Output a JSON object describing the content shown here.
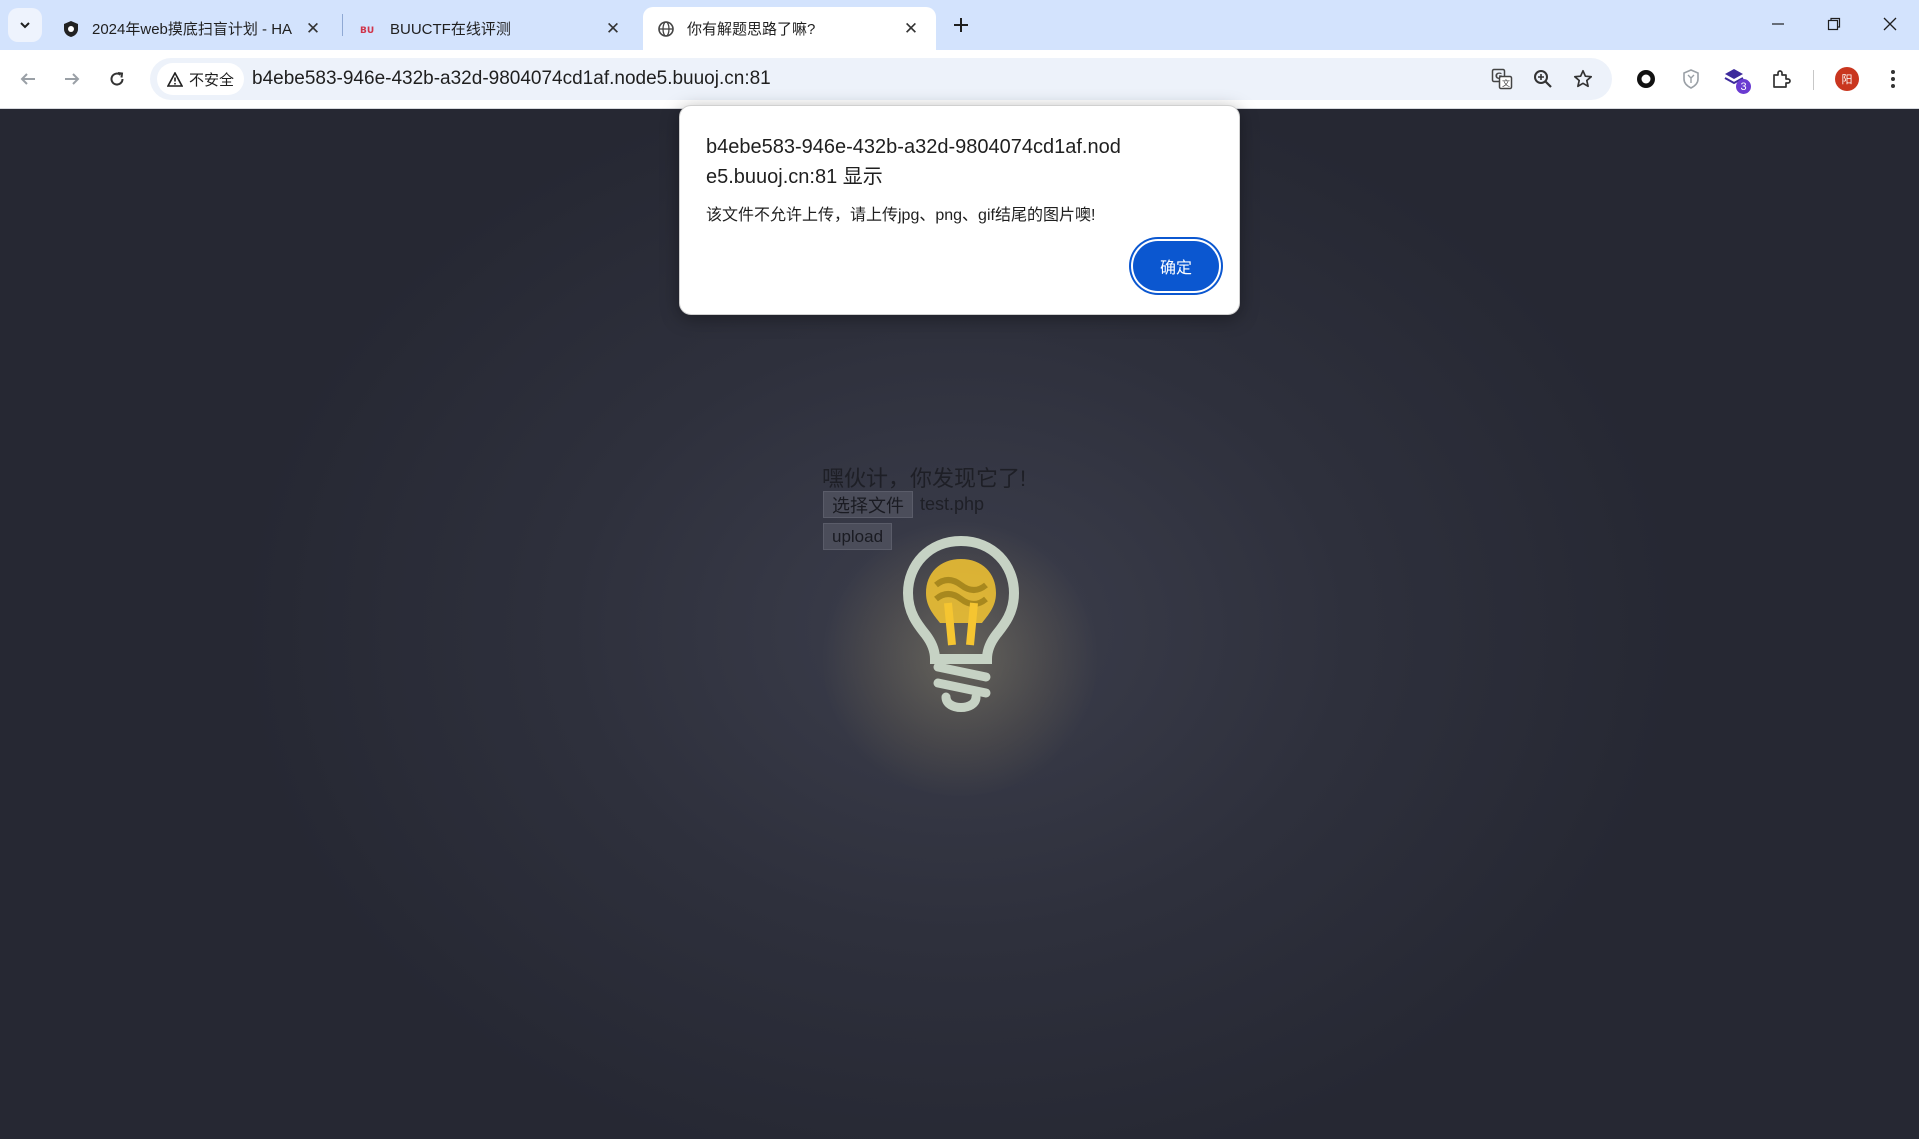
{
  "browser": {
    "tabs": [
      {
        "title": "2024年web摸底扫盲计划 - HA",
        "favicon": "shield-favicon",
        "active": false
      },
      {
        "title": "BUUCTF在线评测",
        "favicon": "buuctf-favicon",
        "active": false
      },
      {
        "title": "你有解题思路了嘛?",
        "favicon": "globe-icon",
        "active": true
      }
    ],
    "security_label": "不安全",
    "url": "b4ebe583-946e-432b-a32d-9804074cd1af.node5.buuoj.cn:81",
    "extension_badge": "3",
    "avatar_letter": "阳"
  },
  "page": {
    "hint_text": "嘿伙计，你发现它了!",
    "choose_file_label": "选择文件",
    "file_name": "test.php",
    "upload_label": "upload"
  },
  "dialog": {
    "title": "b4ebe583-946e-432b-a32d-9804074cd1af.node5.buuoj.cn:81 显示",
    "message": "该文件不允许上传，请上传jpg、png、gif结尾的图片噢!",
    "ok_label": "确定"
  },
  "colors": {
    "tabstrip": "#d3e3fd",
    "page_background": "#2b2d38",
    "dialog_button": "#0b57d0",
    "bulb_yellow": "#f5c531",
    "bulb_outline": "#c6d2c4"
  }
}
